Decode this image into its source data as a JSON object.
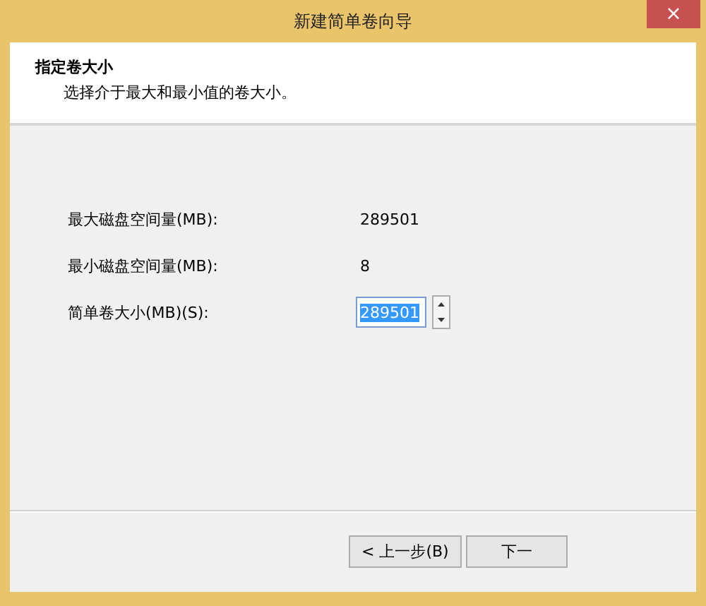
{
  "window": {
    "title": "新建简单卷向导",
    "close": "×"
  },
  "header": {
    "title": "指定卷大小",
    "subtitle": "选择介于最大和最小值的卷大小。"
  },
  "fields": [
    {
      "kind": "readout",
      "label": "最大磁盘空间量(MB):",
      "value": "289501"
    },
    {
      "kind": "readout",
      "label": "最小磁盘空间量(MB):",
      "value": "8"
    },
    {
      "kind": "spin",
      "label": "简单卷大小(MB)(S):",
      "value": "289501",
      "selected": true
    }
  ],
  "buttons": [
    {
      "label": "< 上一步(B)"
    },
    {
      "label": "下一"
    }
  ]
}
